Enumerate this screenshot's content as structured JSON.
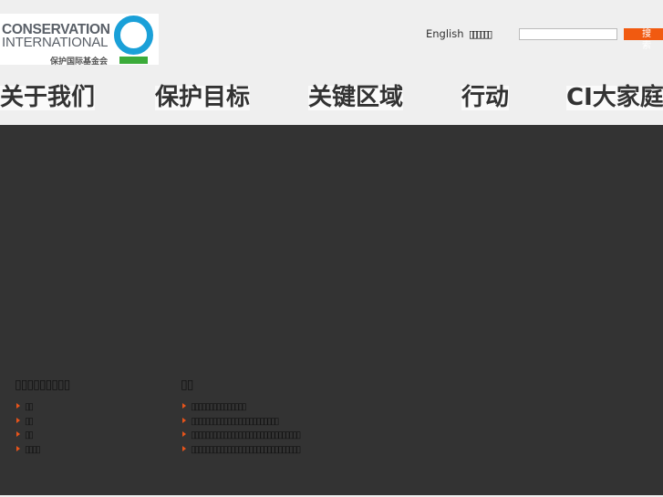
{
  "logo": {
    "line1": "CONSERVATION",
    "line2": "INTERNATIONAL",
    "line3": "保护国际基金会"
  },
  "header": {
    "lang_link": "English",
    "other_link": "▯▯▯▯▯▯",
    "search_value": "",
    "search_button": "搜 索"
  },
  "nav": [
    "关于我们",
    "保护目标",
    "关键区域",
    "行动",
    "CI大家庭"
  ],
  "footer": {
    "col1": {
      "title": "▯▯▯▯▯▯▯▯▯",
      "items": [
        "▯▯",
        "▯▯",
        "▯▯",
        "▯▯▯▯"
      ]
    },
    "col2": {
      "title": "▯▯",
      "items": [
        "▯▯▯▯▯▯▯▯▯▯▯▯▯▯▯",
        "▯▯▯▯▯▯▯▯▯▯▯▯▯▯▯▯▯▯▯▯▯▯▯▯",
        "▯▯▯▯▯▯▯▯▯▯▯▯▯▯▯▯▯▯▯▯▯▯▯▯▯▯▯▯▯▯",
        "▯▯▯▯▯▯▯▯▯▯▯▯▯▯▯▯▯▯▯▯▯▯▯▯▯▯▯▯▯▯"
      ]
    }
  },
  "colors": {
    "accent": "#f15a10",
    "logo_blue": "#1aa0d8",
    "logo_green": "#3bab3a",
    "footer_bg": "#333333"
  }
}
